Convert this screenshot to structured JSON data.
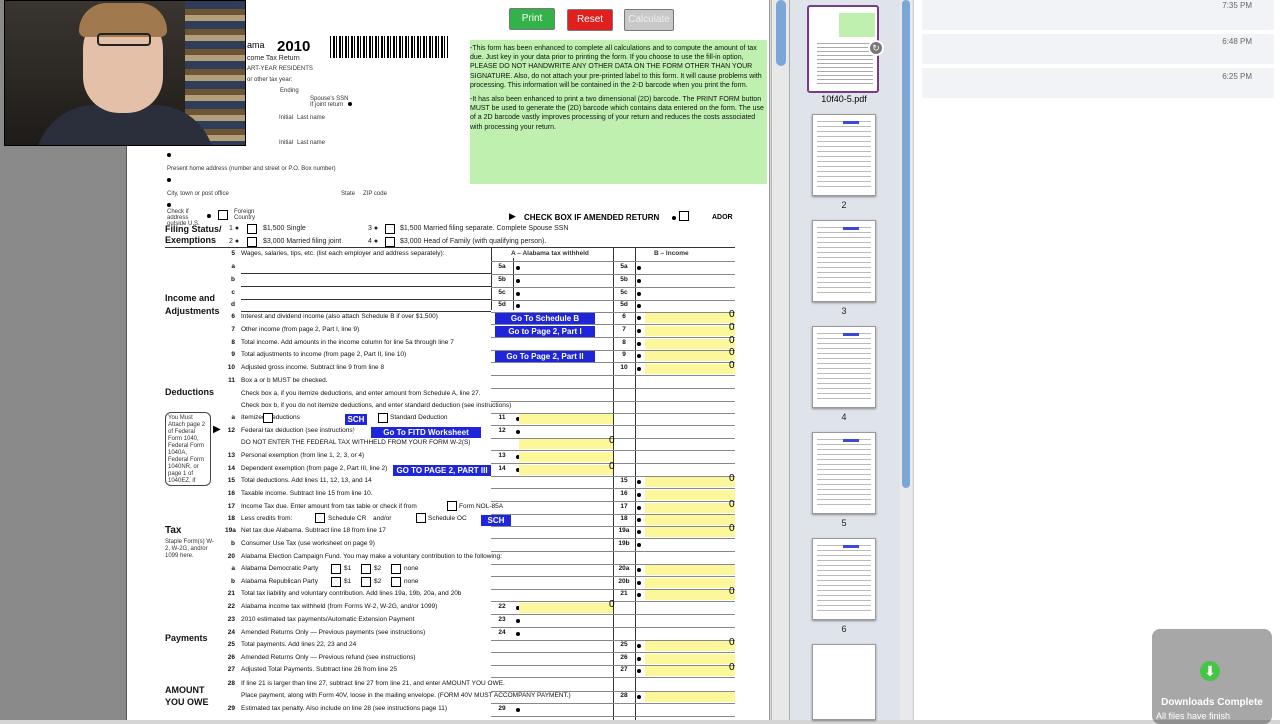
{
  "form": {
    "buttons": {
      "print": "Print",
      "reset": "Reset",
      "calculate": "Calculate"
    },
    "header": {
      "title_fragment": "ama",
      "year": "2010",
      "subtitle": "come Tax Return",
      "subtitle2": "ART-YEAR RESIDENTS"
    },
    "notice_1": "-This form has been enhanced to complete all calculations and to compute the amount of tax due.  Just key in your data prior to printing the form.  If you choose to use the fill-in option, PLEASE DO NOT HANDWRITE ANY OTHER DATA ON THE FORM OTHER THAN YOUR SIGNATURE.  Also, do not attach your pre-printed label to this form.  It will cause problems with processing.  This information will be contained in the 2-D barcode when you print the form.",
    "notice_2": "-It has also been enhanced to print a two dimensional (2D) barcode. The PRINT FORM button MUST be used to generate the (2D) barcode which contains data entered on the form. The use of a 2D barcode vastly improves processing of your return and reduces the costs associated with processing your return.",
    "address_labels": {
      "other_tax_year": "or other tax year:",
      "ending": "Ending",
      "spouse_ssn": "Spouse's SSN",
      "if_joint": "If joint return",
      "initial": "Initial",
      "last_name": "Last name",
      "home_address": "Present home address (number and street or P.O. Box number)",
      "city": "City, town or post office",
      "state": "State",
      "zip": "ZIP code",
      "check_outside": "Check if address outside U.S.",
      "foreign": "Foreign Country",
      "amended": "CHECK BOX IF AMENDED RETURN",
      "ador": "ADOR"
    },
    "sections": {
      "filing": "Filing Status/ Exemptions",
      "income": "Income and Adjustments",
      "deductions": "Deductions",
      "tax": "Tax",
      "payments": "Payments",
      "amount": "AMOUNT YOU OWE"
    },
    "filing_options": [
      "$1,500 Single",
      "$3,000 Married filing joint",
      "$1,500 Married filing separate. Complete Spouse SSN",
      "$3,000 Head of Family (with qualifying person)."
    ],
    "col_a": "A – Alabama tax withheld",
    "col_b": "B – Income",
    "attach_note": "You Must Attach page 2 of Federal Form 1040, Federal Form 1040A, Federal Form 1040NR, or page 1 of 1040EZ, if claiming a deduction on line 12.",
    "staple_note": "Staple Form(s) W-2, W-2G, and/or 1099 here.",
    "blue_buttons": {
      "sched_b": "Go To Schedule B",
      "page2_part1": "Go to Page 2, Part I",
      "page2_part2": "Go To Page 2,  Part II",
      "fitd": "Go To FITD Worksheet",
      "page2_part3": "GO TO PAGE 2, PART III",
      "sch_a": "SCH A",
      "sch_oc": "SCH OC"
    },
    "lines": [
      {
        "n": "5",
        "t": "Wages, salaries, tips, etc. (list each employer and address separately):"
      },
      {
        "n": "a",
        "t": ""
      },
      {
        "n": "b",
        "t": ""
      },
      {
        "n": "c",
        "t": ""
      },
      {
        "n": "d",
        "t": ""
      },
      {
        "n": "6",
        "t": "Interest and dividend income (also attach Schedule B if over $1,500)"
      },
      {
        "n": "7",
        "t": "Other income (from page 2, Part I, line 9)"
      },
      {
        "n": "8",
        "t": "Total income. Add amounts in the income column for line 5a through line 7"
      },
      {
        "n": "9",
        "t": "Total adjustments to income (from page 2, Part II, line 10)"
      },
      {
        "n": "10",
        "t": "Adjusted gross income. Subtract line 9 from line 8"
      },
      {
        "n": "11",
        "t": "Box a or b MUST be checked."
      },
      {
        "n": "",
        "t": "Check box a, if you itemize deductions, and enter amount from Schedule A, line 27."
      },
      {
        "n": "",
        "t": "Check box b, if you do not itemize deductions, and enter standard deduction (see instructions)"
      },
      {
        "n": "a",
        "t": "Itemized Deductions"
      },
      {
        "n": "12",
        "t": "Federal tax deduction (see instructions)"
      },
      {
        "n": "",
        "t": "DO NOT ENTER THE FEDERAL TAX WITHHELD FROM YOUR FORM W-2(S)"
      },
      {
        "n": "13",
        "t": "Personal exemption (from line 1, 2, 3, or 4)"
      },
      {
        "n": "14",
        "t": "Dependent exemption (from page 2, Part III, line 2)"
      },
      {
        "n": "15",
        "t": "Total deductions. Add lines 11, 12, 13, and 14"
      },
      {
        "n": "16",
        "t": "Taxable income. Subtract line 15 from line 10."
      },
      {
        "n": "17",
        "t": "Income Tax due. Enter amount from tax table or check if from"
      },
      {
        "n": "18",
        "t": "Less credits from:"
      },
      {
        "n": "19a",
        "t": "Net tax due Alabama. Subtract line 18 from line 17"
      },
      {
        "n": "b",
        "t": "Consumer Use Tax (use worksheet on page 9)"
      },
      {
        "n": "20",
        "t": "Alabama Election Campaign Fund. You may make a voluntary contribution to the following:"
      },
      {
        "n": "a",
        "t": "Alabama Democratic Party"
      },
      {
        "n": "b",
        "t": "Alabama Republican Party"
      },
      {
        "n": "21",
        "t": "Total tax liability and voluntary contribution. Add lines 19a, 19b, 20a, and 20b"
      },
      {
        "n": "22",
        "t": "Alabama income tax withheld (from Forms W-2, W-2G, and/or 1099)"
      },
      {
        "n": "23",
        "t": "2010 estimated tax payments/Automatic Extension Payment"
      },
      {
        "n": "24",
        "t": "Amended Returns Only — Previous payments (see instructions)"
      },
      {
        "n": "25",
        "t": "Total payments. Add lines 22, 23 and 24"
      },
      {
        "n": "26",
        "t": "Amended Returns Only — Previous refund (see instructions)"
      },
      {
        "n": "27",
        "t": "Adjusted Total Payments. Subtract line 26 from line 25"
      },
      {
        "n": "28",
        "t": "If line 21 is larger than line 27, subtract line 27 from line 21, and enter AMOUNT YOU OWE."
      },
      {
        "n": "",
        "t": "Place payment, along with Form 40V, loose in the mailing envelope. (FORM 40V MUST ACCOMPANY PAYMENT.)"
      },
      {
        "n": "29",
        "t": "Estimated tax penalty. Also include on line 28 (see instructions page 11)"
      }
    ],
    "right_nums": [
      "5a",
      "5b",
      "5c",
      "5d",
      "6",
      "7",
      "8",
      "9",
      "10",
      "15",
      "16",
      "17",
      "18",
      "19a",
      "19b",
      "20a",
      "20b",
      "21",
      "25",
      "26",
      "27",
      "28"
    ],
    "mid_nums": [
      "5a",
      "5b",
      "5c",
      "5d",
      "11",
      "12",
      "13",
      "14",
      "22",
      "23",
      "24",
      "29"
    ],
    "inline_labels": {
      "standard_deduction": "Standard Deduction",
      "form_nol": "Form NOL-85A",
      "schedule_cr": "Schedule CR",
      "and_or": "and/or",
      "schedule_oc": "Schedule OC",
      "s1": "$1",
      "s2": "$2",
      "none": "none"
    },
    "zero": "0"
  },
  "thumbnails": {
    "file_label": "10f40-5.pdf",
    "pages": [
      "2",
      "3",
      "4",
      "5",
      "6"
    ]
  },
  "downloads": {
    "times": [
      "7:35 PM",
      "6:48 PM",
      "6:25 PM"
    ],
    "toast_title": "Downloads Complete",
    "toast_sub": "All files have finish"
  },
  "colors": {
    "print": "#34b24a",
    "reset": "#e0201e",
    "calculate": "#c8c8c8",
    "notice_bg": "#bff0b0",
    "blue_btn": "#1f25d8",
    "field_yellow": "#fbf79a"
  }
}
